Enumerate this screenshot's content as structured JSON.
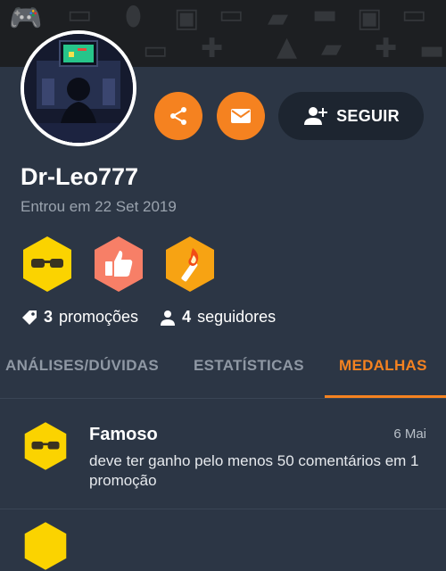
{
  "profile": {
    "username": "Dr-Leo777",
    "joined": "Entrou em 22 Set 2019"
  },
  "actions": {
    "share_icon": "share-icon",
    "message_icon": "mail-icon",
    "follow_label": "SEGUIR",
    "accent": "#f58220"
  },
  "badges": [
    {
      "icon": "sunglasses-icon",
      "color": "#fbd300"
    },
    {
      "icon": "thumbs-up-icon",
      "color": "#f77f67"
    },
    {
      "icon": "torch-icon",
      "color": "#f7a313"
    }
  ],
  "stats": {
    "promotions_count": "3",
    "promotions_label": "promoções",
    "followers_count": "4",
    "followers_label": "seguidores"
  },
  "tabs": [
    {
      "label": "ANÁLISES/DÚVIDAS",
      "active": false
    },
    {
      "label": "ESTATÍSTICAS",
      "active": false
    },
    {
      "label": "MEDALHAS",
      "active": true
    }
  ],
  "medals": [
    {
      "title": "Famoso",
      "date": "6 Mai",
      "description": "deve ter ganho pelo menos 50 comentários em 1 promoção"
    }
  ]
}
